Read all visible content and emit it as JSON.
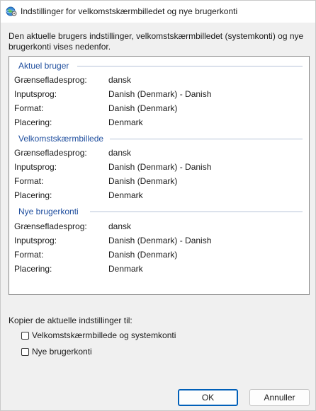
{
  "window": {
    "title": "Indstillinger for velkomstskærmbilledet og nye brugerkonti"
  },
  "intro_text": "Den aktuelle brugers indstillinger, velkomstskærmbilledet (systemkonti) og nye brugerkonti vises nedenfor.",
  "sections": [
    {
      "title": "Aktuel bruger",
      "rows": [
        {
          "label": "Grænsefladesprog:",
          "value": "dansk"
        },
        {
          "label": "Inputsprog:",
          "value": "Danish (Denmark) - Danish"
        },
        {
          "label": "Format:",
          "value": "Danish (Denmark)"
        },
        {
          "label": "Placering:",
          "value": "Denmark"
        }
      ]
    },
    {
      "title": "Velkomstskærmbillede",
      "rows": [
        {
          "label": "Grænsefladesprog:",
          "value": "dansk"
        },
        {
          "label": "Inputsprog:",
          "value": "Danish (Denmark) - Danish"
        },
        {
          "label": "Format:",
          "value": "Danish (Denmark)"
        },
        {
          "label": "Placering:",
          "value": "Denmark"
        }
      ]
    },
    {
      "title": "Nye brugerkonti",
      "rows": [
        {
          "label": "Grænsefladesprog:",
          "value": "dansk"
        },
        {
          "label": "Inputsprog:",
          "value": "Danish (Denmark) - Danish"
        },
        {
          "label": "Format:",
          "value": "Danish (Denmark)"
        },
        {
          "label": "Placering:",
          "value": "Denmark"
        }
      ]
    }
  ],
  "copy": {
    "label": "Kopier de aktuelle indstillinger til:",
    "options": [
      {
        "label": "Velkomstskærmbillede og systemkonti",
        "checked": false
      },
      {
        "label": "Nye brugerkonti",
        "checked": false
      }
    ]
  },
  "buttons": {
    "ok": "OK",
    "cancel": "Annuller"
  },
  "icons": {
    "title_icon": "globe-settings-icon"
  },
  "colors": {
    "section_title": "#1f4e9e",
    "ok_border": "#005fb8"
  }
}
